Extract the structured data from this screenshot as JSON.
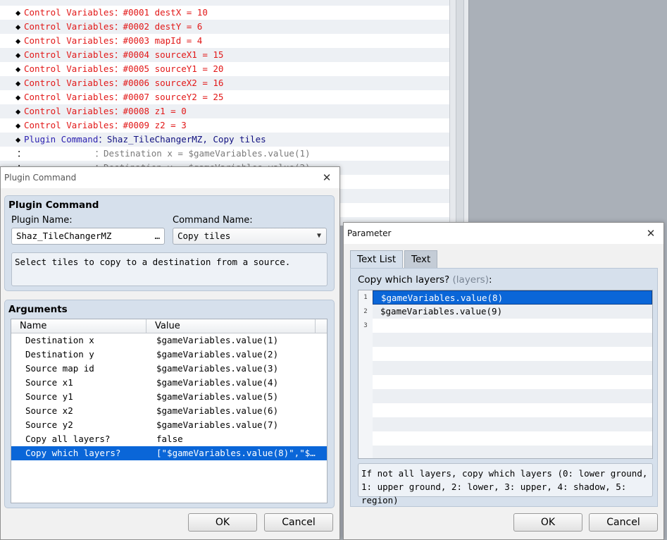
{
  "event_list": {
    "rows": [
      {
        "bullet": "◆",
        "command": "Control Variables",
        "sep": "：",
        "value": "#0001 destX = 10",
        "kind": "variable"
      },
      {
        "bullet": "◆",
        "command": "Control Variables",
        "sep": "：",
        "value": "#0002 destY = 6",
        "kind": "variable"
      },
      {
        "bullet": "◆",
        "command": "Control Variables",
        "sep": "：",
        "value": "#0003 mapId = 4",
        "kind": "variable"
      },
      {
        "bullet": "◆",
        "command": "Control Variables",
        "sep": "：",
        "value": "#0004 sourceX1 = 15",
        "kind": "variable"
      },
      {
        "bullet": "◆",
        "command": "Control Variables",
        "sep": "：",
        "value": "#0005 sourceY1 = 20",
        "kind": "variable"
      },
      {
        "bullet": "◆",
        "command": "Control Variables",
        "sep": "：",
        "value": "#0006 sourceX2 = 16",
        "kind": "variable"
      },
      {
        "bullet": "◆",
        "command": "Control Variables",
        "sep": "：",
        "value": "#0007 sourceY2 = 25",
        "kind": "variable"
      },
      {
        "bullet": "◆",
        "command": "Control Variables",
        "sep": "：",
        "value": "#0008 z1 = 0",
        "kind": "variable"
      },
      {
        "bullet": "◆",
        "command": "Control Variables",
        "sep": "：",
        "value": "#0009 z2 = 3",
        "kind": "variable"
      },
      {
        "bullet": "◆",
        "command": "Plugin Command",
        "sep": "：",
        "value": "Shaz_TileChangerMZ, Copy tiles",
        "kind": "plugin"
      }
    ],
    "continuations": [
      {
        "mark": "：",
        "sep": "：",
        "value": "Destination x = $gameVariables.value(1)"
      },
      {
        "mark": "：",
        "sep": "：",
        "value": "Destination y = $gameVariables.value(2)"
      }
    ]
  },
  "plugin_dialog": {
    "title": "Plugin Command",
    "close_glyph": "✕",
    "group_title": "Plugin Command",
    "plugin_name_label": "Plugin Name:",
    "plugin_name_value": "Shaz_TileChangerMZ",
    "plugin_name_browse": "…",
    "command_name_label": "Command Name:",
    "command_name_value": "Copy tiles",
    "dropdown_arrow": "▼",
    "description": "Select tiles to copy to a destination from a source.",
    "arguments_title": "Arguments",
    "columns": {
      "name": "Name",
      "value": "Value"
    },
    "arguments": [
      {
        "name": "Destination x",
        "value": "$gameVariables.value(1)"
      },
      {
        "name": "Destination y",
        "value": "$gameVariables.value(2)"
      },
      {
        "name": "Source map id",
        "value": "$gameVariables.value(3)"
      },
      {
        "name": "Source x1",
        "value": "$gameVariables.value(4)"
      },
      {
        "name": "Source y1",
        "value": "$gameVariables.value(5)"
      },
      {
        "name": "Source x2",
        "value": "$gameVariables.value(6)"
      },
      {
        "name": "Source y2",
        "value": "$gameVariables.value(7)"
      },
      {
        "name": "Copy all layers?",
        "value": "false"
      },
      {
        "name": "Copy which layers?",
        "value": "[\"$gameVariables.value(8)\",\"$…"
      }
    ],
    "selected_argument_index": 8,
    "ok_label": "OK",
    "cancel_label": "Cancel"
  },
  "parameter_dialog": {
    "title": "Parameter",
    "close_glyph": "✕",
    "tabs": [
      {
        "label": "Text List",
        "active": true
      },
      {
        "label": "Text",
        "active": false
      }
    ],
    "field_label": "Copy which layers?",
    "field_hint": "(layers)",
    "field_colon": ":",
    "items": [
      {
        "num": "1",
        "text": "$gameVariables.value(8)"
      },
      {
        "num": "2",
        "text": "$gameVariables.value(9)"
      },
      {
        "num": "3",
        "text": ""
      }
    ],
    "selected_item_index": 0,
    "help_text": "If not all layers, copy which layers (0: lower ground, 1: upper ground, 2: lower, 3: upper, 4: shadow, 5: region)",
    "ok_label": "OK",
    "cancel_label": "Cancel"
  },
  "colors": {
    "variable_text": "#e21818",
    "plugin_text": "#2a1fb0",
    "selection": "#0a66d8",
    "group_background": "#d6e0ec"
  }
}
